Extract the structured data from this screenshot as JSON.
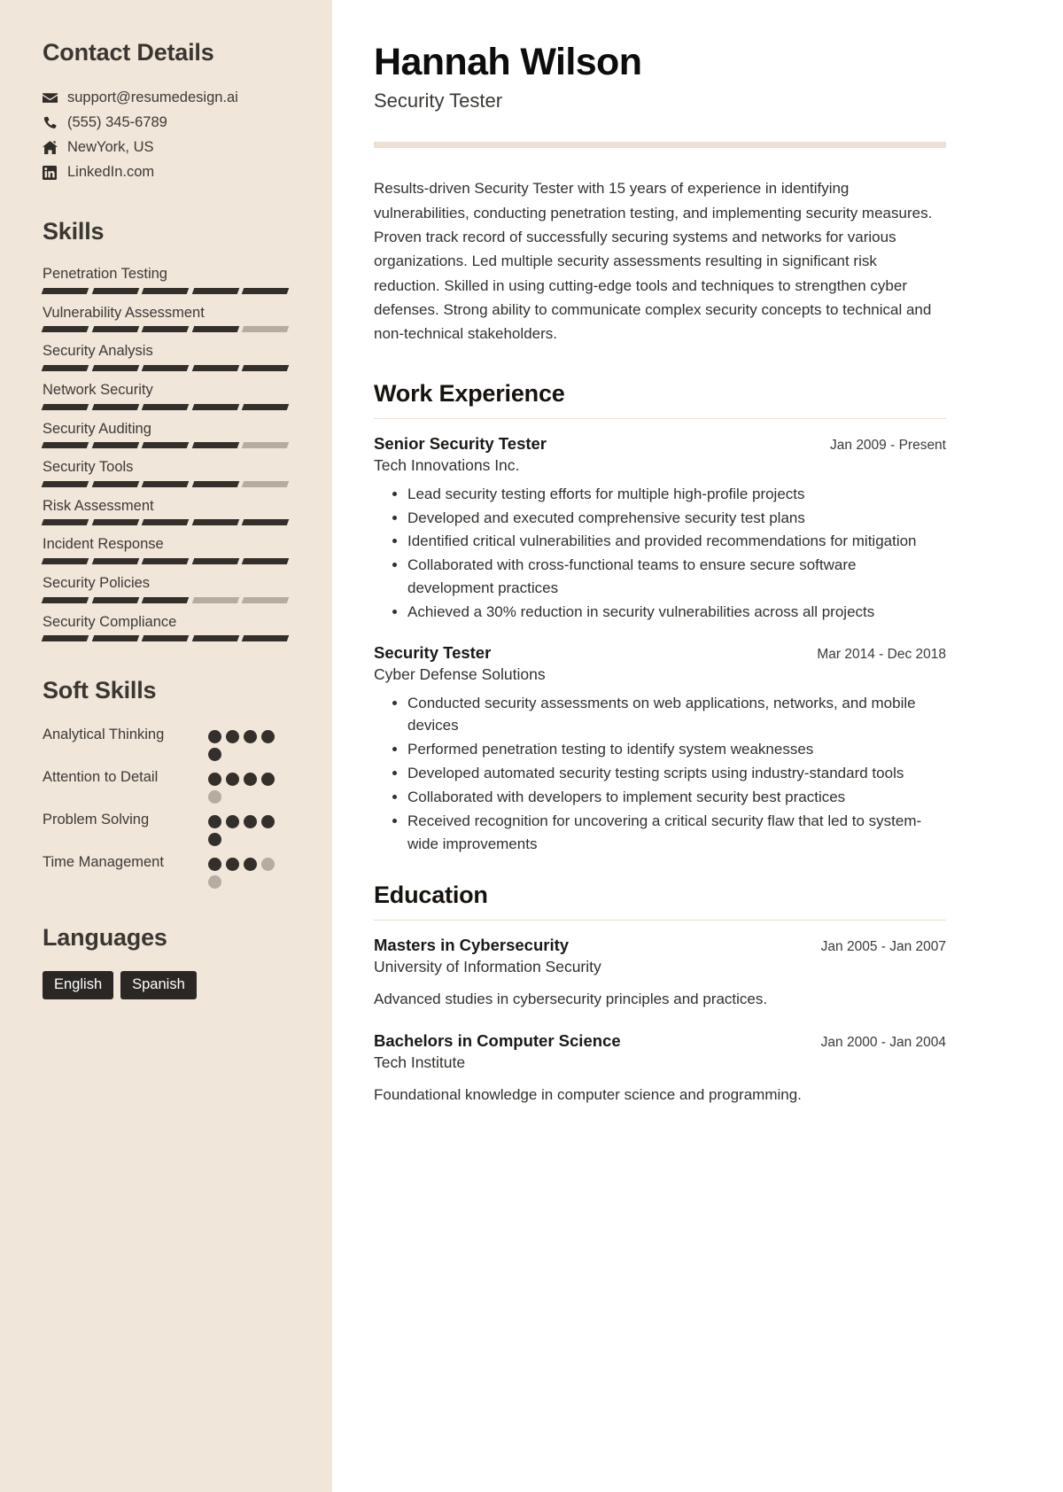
{
  "sidebar": {
    "contact": {
      "heading": "Contact Details",
      "items": [
        {
          "icon": "envelope-icon",
          "text": "support@resumedesign.ai"
        },
        {
          "icon": "phone-icon",
          "text": "(555) 345-6789"
        },
        {
          "icon": "home-icon",
          "text": "NewYork, US"
        },
        {
          "icon": "linkedin-icon",
          "text": "LinkedIn.com"
        }
      ]
    },
    "skills": {
      "heading": "Skills",
      "max": 5,
      "items": [
        {
          "label": "Penetration Testing",
          "level": 5
        },
        {
          "label": "Vulnerability Assessment",
          "level": 4
        },
        {
          "label": "Security Analysis",
          "level": 5
        },
        {
          "label": "Network Security",
          "level": 5
        },
        {
          "label": "Security Auditing",
          "level": 4
        },
        {
          "label": "Security Tools",
          "level": 4
        },
        {
          "label": "Risk Assessment",
          "level": 5
        },
        {
          "label": "Incident Response",
          "level": 5
        },
        {
          "label": "Security Policies",
          "level": 3
        },
        {
          "label": "Security Compliance",
          "level": 5
        }
      ]
    },
    "soft_skills": {
      "heading": "Soft Skills",
      "max": 5,
      "items": [
        {
          "label": "Analytical Thinking",
          "level": 5
        },
        {
          "label": "Attention to Detail",
          "level": 4
        },
        {
          "label": "Problem Solving",
          "level": 5
        },
        {
          "label": "Time Management",
          "level": 3
        }
      ]
    },
    "languages": {
      "heading": "Languages",
      "items": [
        "English",
        "Spanish"
      ]
    }
  },
  "main": {
    "name": "Hannah Wilson",
    "job_title": "Security Tester",
    "summary": "Results-driven Security Tester with 15 years of experience in identifying vulnerabilities, conducting penetration testing, and implementing security measures. Proven track record of successfully securing systems and networks for various organizations. Led multiple security assessments resulting in significant risk reduction. Skilled in using cutting-edge tools and techniques to strengthen cyber defenses. Strong ability to communicate complex security concepts to technical and non-technical stakeholders.",
    "work": {
      "heading": "Work Experience",
      "entries": [
        {
          "role": "Senior Security Tester",
          "org": "Tech Innovations Inc.",
          "date": "Jan 2009 - Present",
          "bullets": [
            "Lead security testing efforts for multiple high-profile projects",
            "Developed and executed comprehensive security test plans",
            "Identified critical vulnerabilities and provided recommendations for mitigation",
            "Collaborated with cross-functional teams to ensure secure software development practices",
            "Achieved a 30% reduction in security vulnerabilities across all projects"
          ]
        },
        {
          "role": "Security Tester",
          "org": "Cyber Defense Solutions",
          "date": "Mar 2014 - Dec 2018",
          "bullets": [
            "Conducted security assessments on web applications, networks, and mobile devices",
            "Performed penetration testing to identify system weaknesses",
            "Developed automated security testing scripts using industry-standard tools",
            "Collaborated with developers to implement security best practices",
            "Received recognition for uncovering a critical security flaw that led to system-wide improvements"
          ]
        }
      ]
    },
    "education": {
      "heading": "Education",
      "entries": [
        {
          "degree": "Masters in Cybersecurity",
          "school": "University of Information Security",
          "date": "Jan 2005 - Jan 2007",
          "description": "Advanced studies in cybersecurity principles and practices."
        },
        {
          "degree": "Bachelors in Computer Science",
          "school": "Tech Institute",
          "date": "Jan 2000 - Jan 2004",
          "description": "Foundational knowledge in computer science and programming."
        }
      ]
    }
  }
}
